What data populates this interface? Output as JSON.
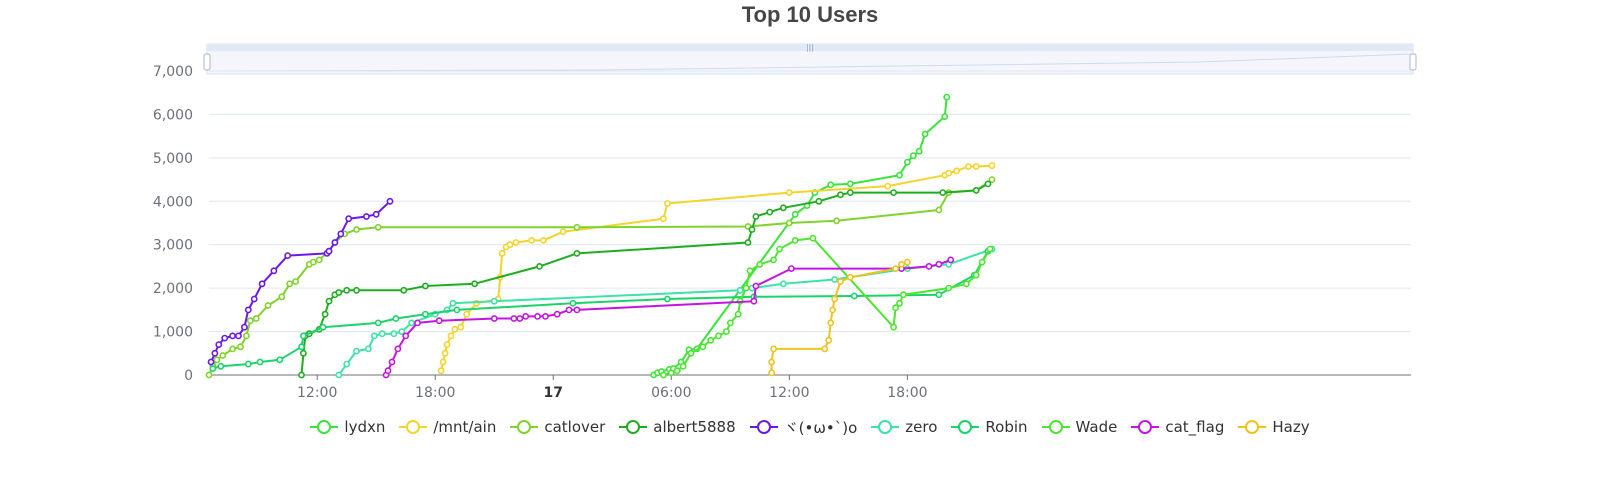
{
  "chart_data": {
    "type": "line",
    "title": "Top 10 Users",
    "ylim": [
      0,
      7000
    ],
    "y_ticks": [
      "0",
      "1,000",
      "2,000",
      "3,000",
      "4,000",
      "5,000",
      "6,000",
      "7,000"
    ],
    "x_range_hours": [
      6.5,
      67.6
    ],
    "x_ticks": [
      {
        "hour": 12,
        "label": "12:00",
        "bold": false
      },
      {
        "hour": 18,
        "label": "18:00",
        "bold": false
      },
      {
        "hour": 24,
        "label": "17",
        "bold": true
      },
      {
        "hour": 30,
        "label": "06:00",
        "bold": false
      },
      {
        "hour": 36,
        "label": "12:00",
        "bold": false
      },
      {
        "hour": 42,
        "label": "18:00",
        "bold": false
      }
    ],
    "grid": true,
    "legend_position": "bottom",
    "datazoom_slider": true,
    "series": [
      {
        "name": "lydxn",
        "color": "#3ae43a",
        "points": [
          [
            29.1,
            0
          ],
          [
            29.3,
            50
          ],
          [
            29.5,
            80
          ],
          [
            29.9,
            130
          ],
          [
            30.1,
            150
          ],
          [
            30.5,
            300
          ],
          [
            30.9,
            580
          ],
          [
            31.3,
            600
          ],
          [
            36.3,
            3700
          ],
          [
            36.9,
            3900
          ],
          [
            37.3,
            4200
          ],
          [
            38.1,
            4380
          ],
          [
            39.1,
            4400
          ],
          [
            41.6,
            4600
          ],
          [
            42.0,
            4900
          ],
          [
            42.3,
            5050
          ],
          [
            42.6,
            5150
          ],
          [
            42.9,
            5550
          ],
          [
            43.9,
            5950
          ],
          [
            44.0,
            6400
          ]
        ]
      },
      {
        "name": "/mnt/ain",
        "color": "#f4d32b",
        "points": [
          [
            18.3,
            100
          ],
          [
            18.4,
            300
          ],
          [
            18.5,
            500
          ],
          [
            18.6,
            700
          ],
          [
            18.8,
            900
          ],
          [
            19.0,
            1050
          ],
          [
            19.3,
            1100
          ],
          [
            19.6,
            1400
          ],
          [
            20.1,
            1650
          ],
          [
            21.2,
            1750
          ],
          [
            21.3,
            2250
          ],
          [
            21.4,
            2800
          ],
          [
            21.6,
            2950
          ],
          [
            21.8,
            3000
          ],
          [
            22.1,
            3050
          ],
          [
            22.9,
            3100
          ],
          [
            23.5,
            3100
          ],
          [
            24.5,
            3300
          ],
          [
            29.6,
            3600
          ],
          [
            29.8,
            3950
          ],
          [
            36.0,
            4200
          ],
          [
            41.0,
            4350
          ],
          [
            43.9,
            4600
          ],
          [
            44.1,
            4650
          ],
          [
            44.5,
            4700
          ],
          [
            45.1,
            4800
          ],
          [
            45.5,
            4800
          ],
          [
            46.3,
            4820
          ]
        ]
      },
      {
        "name": "catlover",
        "color": "#7fd32a",
        "points": [
          [
            6.5,
            0
          ],
          [
            6.7,
            200
          ],
          [
            6.9,
            350
          ],
          [
            7.2,
            450
          ],
          [
            7.7,
            600
          ],
          [
            8.1,
            650
          ],
          [
            8.4,
            900
          ],
          [
            8.6,
            1250
          ],
          [
            8.9,
            1300
          ],
          [
            9.5,
            1600
          ],
          [
            10.2,
            1800
          ],
          [
            10.6,
            2100
          ],
          [
            10.9,
            2150
          ],
          [
            11.6,
            2550
          ],
          [
            11.8,
            2600
          ],
          [
            12.1,
            2650
          ],
          [
            12.6,
            2850
          ],
          [
            12.9,
            3050
          ],
          [
            13.4,
            3250
          ],
          [
            14.0,
            3350
          ],
          [
            15.1,
            3400
          ],
          [
            25.2,
            3400
          ],
          [
            33.9,
            3420
          ],
          [
            36.0,
            3500
          ],
          [
            38.4,
            3550
          ],
          [
            43.6,
            3800
          ],
          [
            44.1,
            4200
          ],
          [
            45.5,
            4250
          ],
          [
            46.3,
            4500
          ]
        ]
      },
      {
        "name": "albert5888",
        "color": "#1fad1f",
        "points": [
          [
            11.2,
            0
          ],
          [
            11.3,
            500
          ],
          [
            11.4,
            900
          ],
          [
            11.6,
            950
          ],
          [
            12.1,
            1050
          ],
          [
            12.4,
            1400
          ],
          [
            12.6,
            1700
          ],
          [
            12.9,
            1850
          ],
          [
            13.1,
            1900
          ],
          [
            13.5,
            1950
          ],
          [
            14.0,
            1950
          ],
          [
            16.4,
            1950
          ],
          [
            17.5,
            2050
          ],
          [
            20.0,
            2100
          ],
          [
            23.3,
            2500
          ],
          [
            25.2,
            2800
          ],
          [
            33.9,
            3050
          ],
          [
            34.1,
            3350
          ],
          [
            34.3,
            3650
          ],
          [
            35.0,
            3750
          ],
          [
            35.7,
            3850
          ],
          [
            37.5,
            4000
          ],
          [
            38.6,
            4150
          ],
          [
            39.1,
            4200
          ],
          [
            41.3,
            4200
          ],
          [
            43.8,
            4200
          ],
          [
            45.5,
            4250
          ],
          [
            46.1,
            4400
          ]
        ]
      },
      {
        "name": "ヾ(•ω•`)o",
        "color": "#6b19e6",
        "points": [
          [
            6.6,
            300
          ],
          [
            6.8,
            500
          ],
          [
            7.0,
            700
          ],
          [
            7.3,
            850
          ],
          [
            7.7,
            900
          ],
          [
            8.0,
            900
          ],
          [
            8.3,
            1100
          ],
          [
            8.5,
            1500
          ],
          [
            8.8,
            1750
          ],
          [
            9.2,
            2100
          ],
          [
            9.8,
            2400
          ],
          [
            10.5,
            2750
          ],
          [
            12.5,
            2800
          ],
          [
            12.6,
            2850
          ],
          [
            12.9,
            3050
          ],
          [
            13.2,
            3250
          ],
          [
            13.6,
            3600
          ],
          [
            14.5,
            3650
          ],
          [
            15.0,
            3700
          ],
          [
            15.7,
            4000
          ]
        ]
      },
      {
        "name": "zero",
        "color": "#3ce2a6",
        "points": [
          [
            13.1,
            0
          ],
          [
            13.5,
            250
          ],
          [
            14.0,
            550
          ],
          [
            14.6,
            600
          ],
          [
            14.9,
            900
          ],
          [
            15.3,
            950
          ],
          [
            15.9,
            950
          ],
          [
            16.3,
            1000
          ],
          [
            16.8,
            1200
          ],
          [
            18.0,
            1400
          ],
          [
            18.6,
            1500
          ],
          [
            18.9,
            1650
          ],
          [
            21.0,
            1700
          ],
          [
            33.5,
            1950
          ],
          [
            34.1,
            2000
          ],
          [
            35.7,
            2100
          ],
          [
            38.3,
            2200
          ],
          [
            42.0,
            2450
          ],
          [
            44.1,
            2550
          ],
          [
            46.3,
            2900
          ]
        ]
      },
      {
        "name": "Robin",
        "color": "#1ad46a",
        "points": [
          [
            6.7,
            150
          ],
          [
            7.1,
            200
          ],
          [
            8.5,
            250
          ],
          [
            9.1,
            300
          ],
          [
            10.1,
            350
          ],
          [
            11.2,
            650
          ],
          [
            11.3,
            900
          ],
          [
            12.3,
            1100
          ],
          [
            15.1,
            1200
          ],
          [
            16.0,
            1300
          ],
          [
            17.5,
            1400
          ],
          [
            19.1,
            1500
          ],
          [
            25.0,
            1650
          ],
          [
            29.8,
            1750
          ],
          [
            34.2,
            1800
          ],
          [
            39.3,
            1820
          ],
          [
            43.6,
            1850
          ],
          [
            45.4,
            2300
          ],
          [
            46.1,
            2850
          ]
        ]
      },
      {
        "name": "Wade",
        "color": "#4ce62e",
        "points": [
          [
            29.6,
            0
          ],
          [
            30.0,
            50
          ],
          [
            30.3,
            100
          ],
          [
            30.6,
            200
          ],
          [
            31.0,
            500
          ],
          [
            31.6,
            650
          ],
          [
            32.0,
            800
          ],
          [
            32.4,
            900
          ],
          [
            32.8,
            1000
          ],
          [
            33.0,
            1200
          ],
          [
            33.4,
            1400
          ],
          [
            33.5,
            1700
          ],
          [
            33.8,
            2000
          ],
          [
            34.0,
            2400
          ],
          [
            34.5,
            2550
          ],
          [
            35.2,
            2650
          ],
          [
            35.5,
            2900
          ],
          [
            36.3,
            3100
          ],
          [
            37.2,
            3150
          ],
          [
            41.3,
            1100
          ],
          [
            41.4,
            1550
          ],
          [
            41.6,
            1650
          ],
          [
            41.8,
            1850
          ],
          [
            44.1,
            2000
          ],
          [
            45.0,
            2100
          ],
          [
            45.5,
            2300
          ],
          [
            45.8,
            2600
          ],
          [
            46.2,
            2900
          ]
        ]
      },
      {
        "name": "cat_flag",
        "color": "#c314e3",
        "points": [
          [
            15.5,
            0
          ],
          [
            15.6,
            100
          ],
          [
            15.8,
            300
          ],
          [
            16.1,
            600
          ],
          [
            16.5,
            900
          ],
          [
            17.1,
            1200
          ],
          [
            18.2,
            1250
          ],
          [
            21.0,
            1300
          ],
          [
            22.0,
            1300
          ],
          [
            22.3,
            1300
          ],
          [
            22.6,
            1350
          ],
          [
            23.2,
            1350
          ],
          [
            23.6,
            1350
          ],
          [
            24.2,
            1400
          ],
          [
            24.8,
            1500
          ],
          [
            25.2,
            1500
          ],
          [
            34.2,
            1700
          ],
          [
            34.3,
            2050
          ],
          [
            36.1,
            2450
          ],
          [
            41.7,
            2450
          ],
          [
            43.1,
            2500
          ],
          [
            43.6,
            2550
          ],
          [
            44.2,
            2650
          ]
        ]
      },
      {
        "name": "Hazy",
        "color": "#f0c21e",
        "points": [
          [
            35.1,
            50
          ],
          [
            35.1,
            300
          ],
          [
            35.2,
            600
          ],
          [
            37.8,
            600
          ],
          [
            38.0,
            800
          ],
          [
            38.1,
            1200
          ],
          [
            38.2,
            1500
          ],
          [
            38.3,
            1750
          ],
          [
            38.6,
            2150
          ],
          [
            39.1,
            2250
          ],
          [
            41.4,
            2450
          ],
          [
            41.7,
            2550
          ],
          [
            42.0,
            2600
          ]
        ]
      }
    ]
  }
}
